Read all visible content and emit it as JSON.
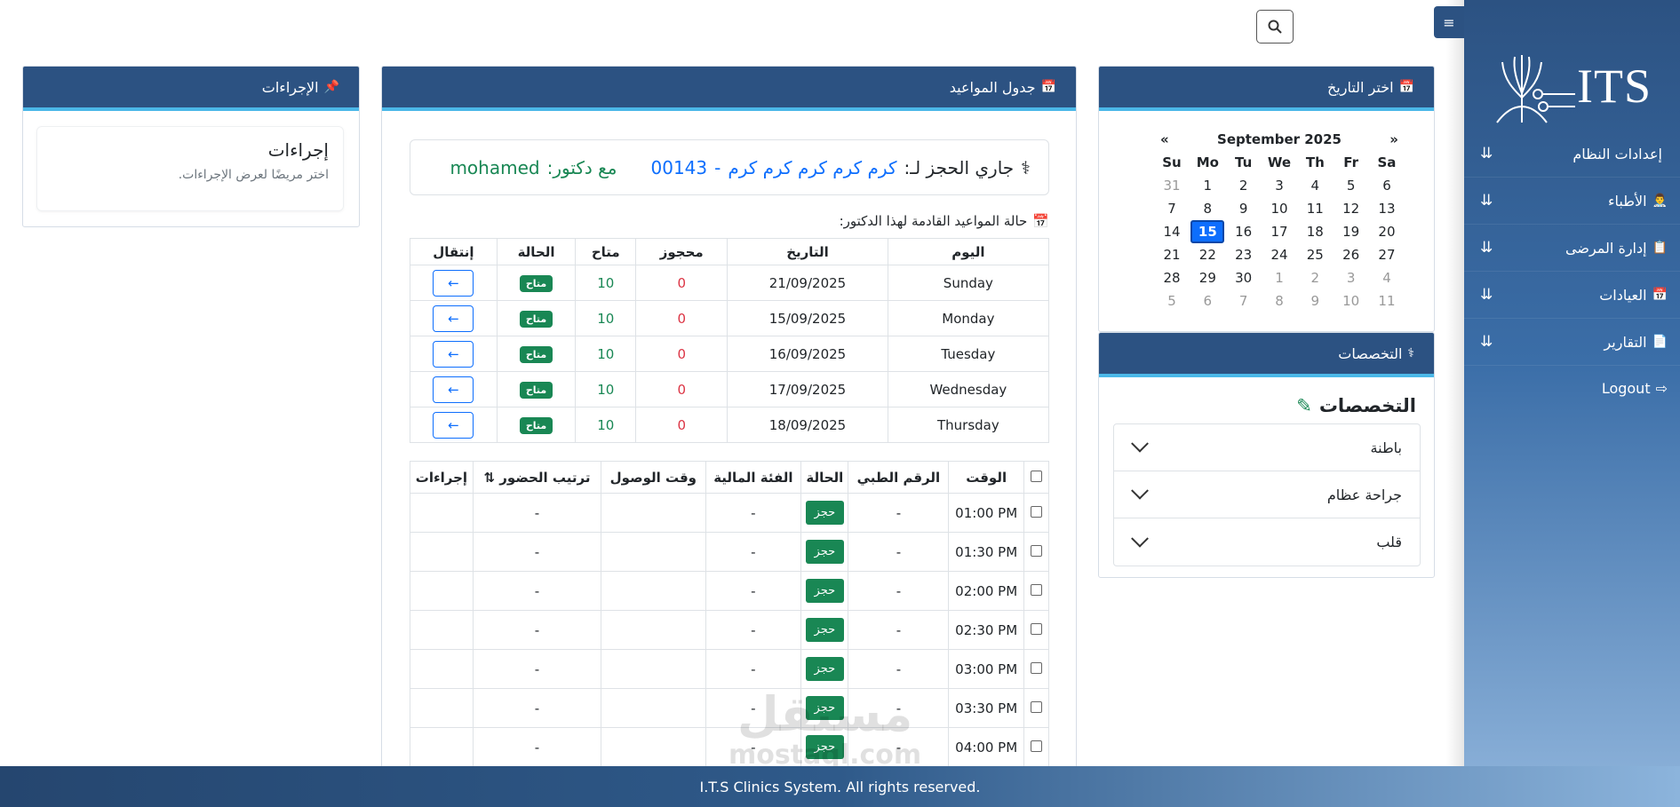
{
  "sidebar": {
    "logo_text": "ITS",
    "items": [
      {
        "label": "إعدادات النظام",
        "icon": ""
      },
      {
        "label": "الأطباء",
        "icon": "👨‍⚕️"
      },
      {
        "label": "إدارة المرضى",
        "icon": "📋"
      },
      {
        "label": "العيادات",
        "icon": "📅"
      },
      {
        "label": "التقارير",
        "icon": "📄"
      }
    ],
    "logout": "Logout"
  },
  "toggle_icon": "≡",
  "calendar_panel": {
    "title": "اختر التاريخ",
    "icon": "📅",
    "month": "September 2025",
    "prev": "«",
    "next": "»",
    "dow": [
      "Su",
      "Mo",
      "Tu",
      "We",
      "Th",
      "Fr",
      "Sa"
    ],
    "weeks": [
      [
        {
          "d": "31",
          "m": true
        },
        {
          "d": "1"
        },
        {
          "d": "2"
        },
        {
          "d": "3"
        },
        {
          "d": "4"
        },
        {
          "d": "5"
        },
        {
          "d": "6"
        }
      ],
      [
        {
          "d": "7"
        },
        {
          "d": "8"
        },
        {
          "d": "9"
        },
        {
          "d": "10"
        },
        {
          "d": "11"
        },
        {
          "d": "12"
        },
        {
          "d": "13"
        }
      ],
      [
        {
          "d": "14"
        },
        {
          "d": "15",
          "today": true
        },
        {
          "d": "16"
        },
        {
          "d": "17"
        },
        {
          "d": "18"
        },
        {
          "d": "19"
        },
        {
          "d": "20"
        }
      ],
      [
        {
          "d": "21"
        },
        {
          "d": "22"
        },
        {
          "d": "23"
        },
        {
          "d": "24"
        },
        {
          "d": "25"
        },
        {
          "d": "26"
        },
        {
          "d": "27"
        }
      ],
      [
        {
          "d": "28"
        },
        {
          "d": "29"
        },
        {
          "d": "30"
        },
        {
          "d": "1",
          "m": true
        },
        {
          "d": "2",
          "m": true
        },
        {
          "d": "3",
          "m": true
        },
        {
          "d": "4",
          "m": true
        }
      ],
      [
        {
          "d": "5",
          "m": true
        },
        {
          "d": "6",
          "m": true
        },
        {
          "d": "7",
          "m": true
        },
        {
          "d": "8",
          "m": true
        },
        {
          "d": "9",
          "m": true
        },
        {
          "d": "10",
          "m": true
        },
        {
          "d": "11",
          "m": true
        }
      ]
    ]
  },
  "specialties_panel": {
    "title": "التخصصات",
    "heading": "التخصصات",
    "items": [
      "باطنة",
      "جراحة عظام",
      "قلب"
    ]
  },
  "appointments_panel": {
    "title": "جدول المواعيد",
    "booking_label": "جاري الحجز لـ:",
    "patient_name": "كرم كرم كرم كرم كرم",
    "separator": "-",
    "patient_code": "00143",
    "doctor_label": "مع دكتور:",
    "doctor_name": "mohamed",
    "status_title": "حالة المواعيد القادمة لهذا الدكتور:",
    "days_headers": [
      "اليوم",
      "التاريخ",
      "محجوز",
      "متاح",
      "الحالة",
      "إنتقال"
    ],
    "days": [
      {
        "day": "Sunday",
        "date": "21/09/2025",
        "booked": "0",
        "available": "10",
        "status": "متاح",
        "go": "←"
      },
      {
        "day": "Monday",
        "date": "15/09/2025",
        "booked": "0",
        "available": "10",
        "status": "متاح",
        "go": "←"
      },
      {
        "day": "Tuesday",
        "date": "16/09/2025",
        "booked": "0",
        "available": "10",
        "status": "متاح",
        "go": "←"
      },
      {
        "day": "Wednesday",
        "date": "17/09/2025",
        "booked": "0",
        "available": "10",
        "status": "متاح",
        "go": "←"
      },
      {
        "day": "Thursday",
        "date": "18/09/2025",
        "booked": "0",
        "available": "10",
        "status": "متاح",
        "go": "←"
      }
    ],
    "slots_headers": [
      "الوقت",
      "الرقم الطبي",
      "الحالة",
      "الفئة المالية",
      "وقت الوصول",
      "ترتيب الحضور ⇅",
      "إجراءات"
    ],
    "slots": [
      {
        "time": "01:00 PM",
        "mrn": "-",
        "status": "حجز",
        "category": "-",
        "arrival": "",
        "order": "-",
        "actions": ""
      },
      {
        "time": "01:30 PM",
        "mrn": "-",
        "status": "حجز",
        "category": "-",
        "arrival": "",
        "order": "-",
        "actions": ""
      },
      {
        "time": "02:00 PM",
        "mrn": "-",
        "status": "حجز",
        "category": "-",
        "arrival": "",
        "order": "-",
        "actions": ""
      },
      {
        "time": "02:30 PM",
        "mrn": "-",
        "status": "حجز",
        "category": "-",
        "arrival": "",
        "order": "-",
        "actions": ""
      },
      {
        "time": "03:00 PM",
        "mrn": "-",
        "status": "حجز",
        "category": "-",
        "arrival": "",
        "order": "-",
        "actions": ""
      },
      {
        "time": "03:30 PM",
        "mrn": "-",
        "status": "حجز",
        "category": "-",
        "arrival": "",
        "order": "-",
        "actions": ""
      },
      {
        "time": "04:00 PM",
        "mrn": "-",
        "status": "حجز",
        "category": "-",
        "arrival": "",
        "order": "-",
        "actions": ""
      }
    ]
  },
  "procedures_panel": {
    "title": "الإجراءات",
    "icon": "📌",
    "card_title": "إجراءات",
    "card_text": "اختر مريضًا لعرض الإجراءات."
  },
  "watermark": {
    "big": "مستقل",
    "small": "mostaql.com"
  },
  "footer": "I.T.S Clinics System. All rights reserved.",
  "colors": {
    "primary": "#2c5282",
    "accent": "#4bb8e8",
    "success": "#198754",
    "link": "#0d6efd",
    "danger": "#dc3545"
  }
}
